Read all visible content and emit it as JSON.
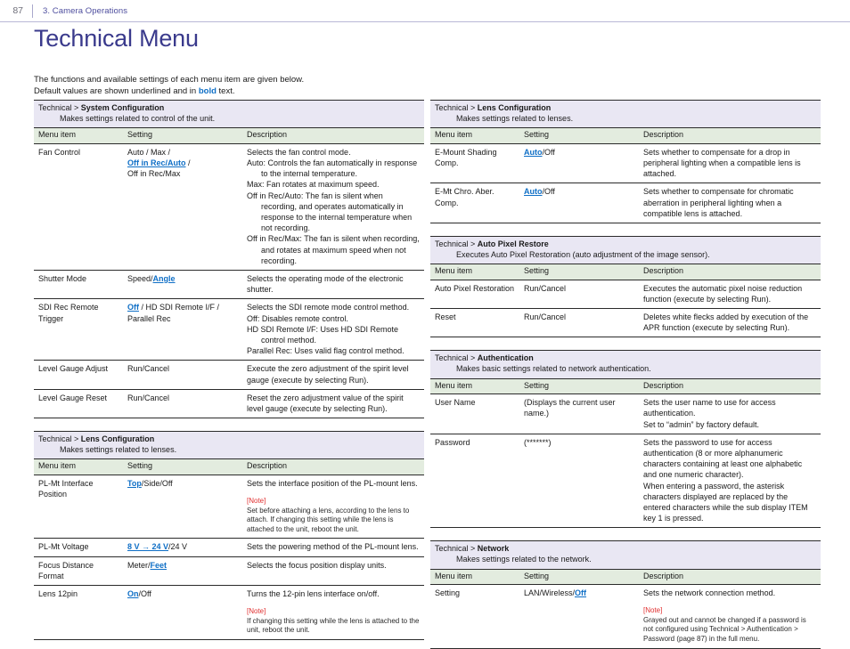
{
  "header": {
    "page_number": "87",
    "chapter": "3. Camera Operations"
  },
  "title": "Technical Menu",
  "intro": {
    "line1": "The functions and available settings of each menu item are given below.",
    "line2_a": "Default values are shown underlined and in ",
    "line2_bold": "bold",
    "line2_b": " text."
  },
  "colors": {
    "title": "#3a3a8c",
    "section_header_bg": "#e9e7f3",
    "column_header_bg": "#e3ecdf",
    "default_value": "#0f6fc6",
    "note_label": "#e03030",
    "chapter_text": "#4e4e9e"
  },
  "column_headers": {
    "menu_item": "Menu item",
    "setting": "Setting",
    "description": "Description"
  },
  "left_column": [
    {
      "path_prefix": "Technical > ",
      "path_name": "System Configuration",
      "path_desc": "Makes settings related to control of the unit.",
      "rows": [
        {
          "item": "Fan Control",
          "setting_html": "Auto / Max /<br><span class=\"dflt\">Off in Rec/Auto</span> /<br>Off in Rec/Max",
          "desc_html": "Selects the fan control mode.<div class=\"hang\">Auto: Controls the fan automatically in response to the internal temperature.</div><div class=\"hang\">Max: Fan rotates at maximum speed.</div><div class=\"hang\">Off in Rec/Auto: The fan is silent when recording, and operates automatically in response to the internal temperature when not recording.</div><div class=\"hang\">Off in Rec/Max: The fan is silent when recording, and rotates at maximum speed when not recording.</div>"
        },
        {
          "item": "Shutter Mode",
          "setting_html": "Speed/<span class=\"dflt\">Angle</span>",
          "desc_html": "Selects the operating mode of the electronic shutter."
        },
        {
          "item": "SDI Rec Remote Trigger",
          "setting_html": "<span class=\"dflt\">Off</span> / HD SDI Remote I/F /<br>Parallel Rec",
          "desc_html": "Selects the SDI remote mode control method.<div class=\"hang\">Off: Disables remote control.</div><div class=\"hang\">HD SDI Remote I/F: Uses HD SDI Remote control method.</div><div class=\"hang\">Parallel Rec: Uses valid flag control method.</div>"
        },
        {
          "item": "Level Gauge Adjust",
          "setting_html": "Run/Cancel",
          "desc_html": "Execute the zero adjustment of the spirit level gauge (execute by selecting Run)."
        },
        {
          "item": "Level Gauge Reset",
          "setting_html": "Run/Cancel",
          "desc_html": "Reset the zero adjustment value of the spirit level gauge (execute by selecting Run)."
        }
      ]
    },
    {
      "path_prefix": "Technical > ",
      "path_name": "Lens Configuration",
      "path_desc": "Makes settings related to lenses.",
      "rows": [
        {
          "item": "PL-Mt Interface Position",
          "setting_html": "<span class=\"dflt\">Top</span>/Side/Off",
          "desc_html": "Sets the interface position of the PL-mount lens.<div class=\"note-block\"><div class=\"note-label\">[Note]</div><div class=\"note-text\">Set before attaching a lens, according to the lens to attach. If changing this setting while the lens is attached to the unit, reboot the unit.</div></div>"
        },
        {
          "item": "PL-Mt Voltage",
          "setting_html": "<span class=\"dflt\">8 V <span class=\"arrow\">&#8594;</span> 24 V</span>/24 V",
          "desc_html": "Sets the powering method of the PL-mount lens."
        },
        {
          "item": "Focus Distance Format",
          "setting_html": "Meter/<span class=\"dflt\">Feet</span>",
          "desc_html": "Selects the focus position display units."
        },
        {
          "item": "Lens 12pin",
          "setting_html": "<span class=\"dflt\">On</span>/Off",
          "desc_html": "Turns the 12-pin lens interface on/off.<div class=\"note-block\"><div class=\"note-label\">[Note]</div><div class=\"note-text\">If changing this setting while the lens is attached to the unit, reboot the unit.</div></div>"
        }
      ]
    }
  ],
  "right_column": [
    {
      "path_prefix": "Technical > ",
      "path_name": "Lens Configuration",
      "path_desc": "Makes settings related to lenses.",
      "rows": [
        {
          "item": "E-Mount Shading Comp.",
          "setting_html": "<span class=\"dflt\">Auto</span>/Off",
          "desc_html": "Sets whether to compensate for a drop in peripheral lighting when a compatible lens is attached."
        },
        {
          "item": "E-Mt Chro. Aber. Comp.",
          "setting_html": "<span class=\"dflt\">Auto</span>/Off",
          "desc_html": "Sets whether to compensate for chromatic aberration in peripheral lighting when a compatible lens is attached."
        }
      ]
    },
    {
      "path_prefix": "Technical > ",
      "path_name": "Auto Pixel Restore",
      "path_desc": "Executes Auto Pixel Restoration (auto adjustment of the image sensor).",
      "rows": [
        {
          "item": "Auto Pixel Restoration",
          "setting_html": "Run/Cancel",
          "desc_html": "Executes the automatic pixel noise reduction function (execute by selecting Run)."
        },
        {
          "item": "Reset",
          "setting_html": "Run/Cancel",
          "desc_html": "Deletes white flecks added by execution of the APR function (execute by selecting Run)."
        }
      ]
    },
    {
      "path_prefix": "Technical > ",
      "path_name": "Authentication",
      "path_desc": "Makes basic settings related to network authentication.",
      "rows": [
        {
          "item": "User Name",
          "setting_html": "(Displays the current user name.)",
          "desc_html": "Sets the user name to use for access authentication.<br>Set to &ldquo;admin&rdquo; by factory default."
        },
        {
          "item": "Password",
          "setting_html": "(*******)",
          "desc_html": "Sets the password to use for access authentication (8 or more alphanumeric characters containing at least one alphabetic and one numeric character).<br>When entering a password, the asterisk characters displayed are replaced by the entered characters while the sub display ITEM key 1 is pressed."
        }
      ]
    },
    {
      "path_prefix": "Technical > ",
      "path_name": "Network",
      "path_desc": "Makes settings related to the network.",
      "rows": [
        {
          "item": "Setting",
          "setting_html": "LAN/Wireless/<span class=\"dflt\">Off</span>",
          "desc_html": "Sets the network connection method.<div class=\"note-block\"><div class=\"note-label\">[Note]</div><div class=\"note-text\">Grayed out and cannot be changed if a password is not configured using Technical &gt; Authentication &gt; Password (page 87) in the full menu.</div></div>"
        }
      ]
    }
  ]
}
